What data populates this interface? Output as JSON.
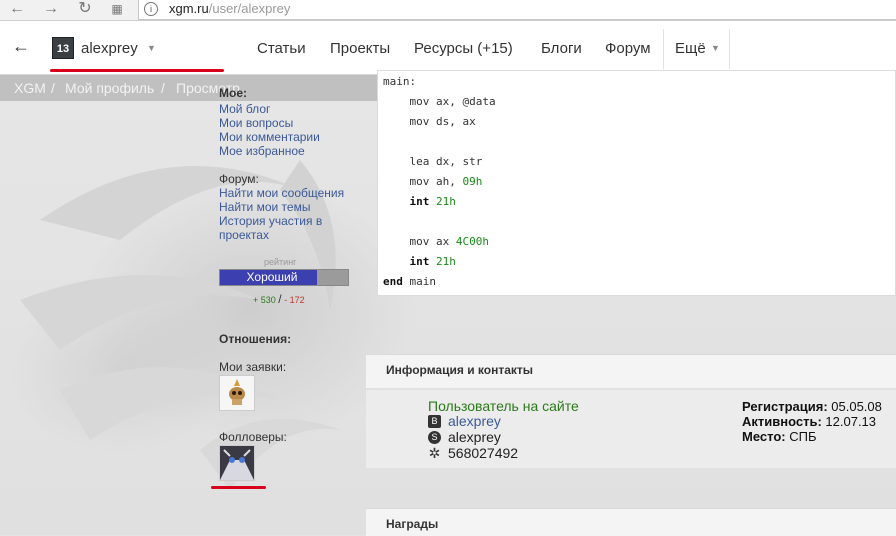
{
  "browser": {
    "url_host": "xgm.ru",
    "url_path": "/user/alexprey"
  },
  "header": {
    "logo_text": "13",
    "username": "alexprey",
    "menu": [
      "Статьи",
      "Проекты",
      "Ресурсы (+15)",
      "Блоги",
      "Форум",
      "Ещё"
    ]
  },
  "breadcrumb": [
    "XGM",
    "/",
    "Мой профиль",
    "/",
    "Просмотр"
  ],
  "sidebar": {
    "mine_title": "Мое:",
    "mine_links": [
      "Мой блог",
      "Мои вопросы",
      "Мои комментарии",
      "Мое избранное"
    ],
    "forum_title": "Форум:",
    "forum_links": [
      "Найти мои сообщения",
      "Найти мои темы",
      "История участия в",
      "проектах"
    ],
    "rating_label": "рейтинг",
    "rating_text": "Хороший",
    "rating_positive": "+ 530",
    "rating_sep": "/",
    "rating_negative": "- 172",
    "rating_fraction": 0.755,
    "relations_title": "Отношения:",
    "requests_label": "Мои заявки:",
    "followers_label": "Фолловеры:"
  },
  "code": {
    "l1": "main:",
    "l2a": "    mov ax, @data",
    "l3a": "    mov ds, ax",
    "l4a": "    lea dx, str",
    "l5a": "    mov ah, ",
    "l5b": "09h",
    "l6a": "    ",
    "l6b": "int",
    "l6c": " ",
    "l6d": "21h",
    "l7a": "    mov ax ",
    "l7b": "4C00h",
    "l8a": "    ",
    "l8b": "int",
    "l8c": " ",
    "l8d": "21h",
    "l9a": "end",
    "l9b": " main"
  },
  "info": {
    "title": "Информация и контакты",
    "online": "Пользователь на сайте",
    "vk": "alexprey",
    "skype": "alexprey",
    "icq": "568027492",
    "reg_label": "Регистрация:",
    "reg_value": " 05.05.08",
    "act_label": "Активность:",
    "act_value": " 12.07.13",
    "place_label": "Место:",
    "place_value": " СПБ"
  },
  "awards": {
    "title": "Награды"
  },
  "colors": {
    "accent_red": "#d9001b",
    "rating_blue": "#3b3fb0",
    "link": "#3b5998",
    "online_green": "#2a7a1a"
  }
}
